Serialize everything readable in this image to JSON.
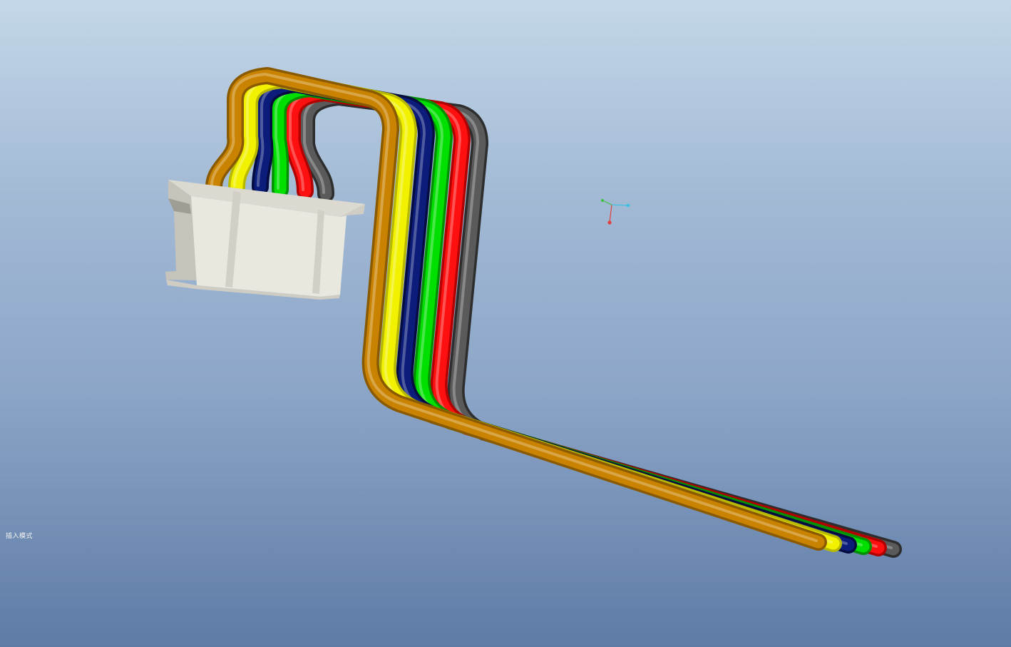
{
  "viewport": {
    "status_text": "插入模式"
  },
  "cable": {
    "wire_colors": [
      "#c98300",
      "#f2f200",
      "#0c1c7a",
      "#00e000",
      "#ff1010",
      "#5a5a5a"
    ],
    "wire_shades": [
      "#8a5a00",
      "#b8b800",
      "#050c40",
      "#009000",
      "#b00000",
      "#2e2e2e"
    ]
  },
  "connector": {
    "body_color": "#e8e6dd",
    "shade_color": "#c9c7bd",
    "dark_color": "#a9a79d"
  },
  "triad": {
    "x_color": "#e04040",
    "y_color": "#40c040",
    "z_color": "#40c0e0"
  }
}
